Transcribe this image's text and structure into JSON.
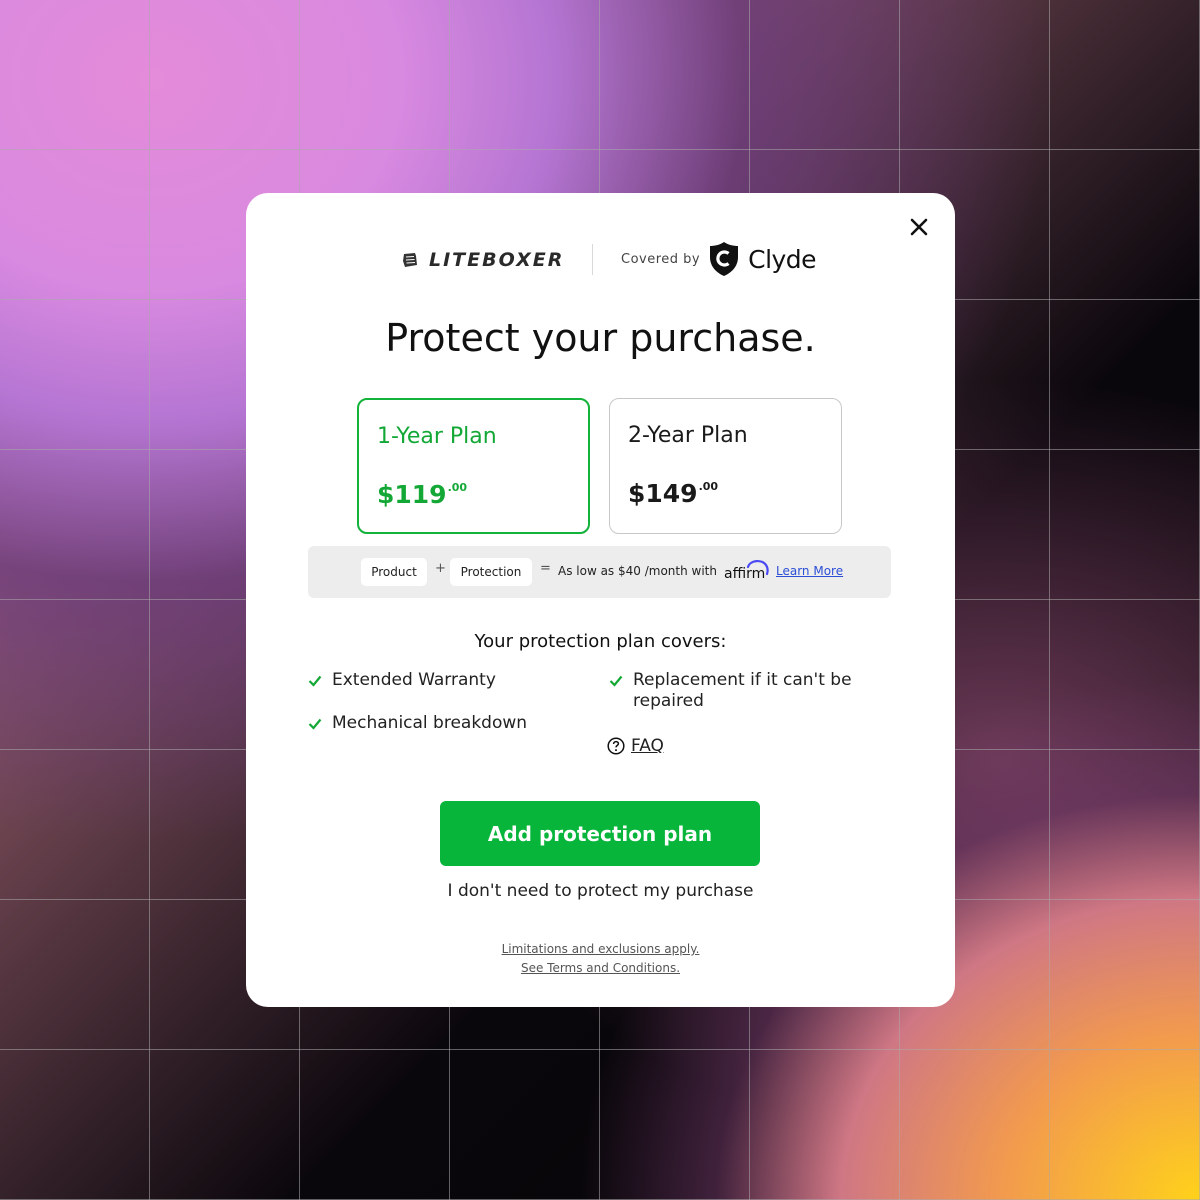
{
  "brand": {
    "merchant": "LITEBOXER",
    "covered_by": "Covered by",
    "provider": "Clyde"
  },
  "title": "Protect your purchase.",
  "plans": [
    {
      "name": "1-Year Plan",
      "price": "$119",
      "cents": ".00",
      "selected": true
    },
    {
      "name": "2-Year Plan",
      "price": "$149",
      "cents": ".00",
      "selected": false
    }
  ],
  "financing": {
    "product_label": "Product",
    "plus": "+",
    "protection_label": "Protection",
    "equals": "=",
    "text": "As low as $40 /month with",
    "learn_more": "Learn More",
    "affirm_logo_text": "affirm"
  },
  "coverage": {
    "title": "Your protection plan covers:",
    "items": [
      "Extended Warranty",
      "Mechanical breakdown",
      "Replacement if it can't be repaired"
    ],
    "faq_label": "FAQ"
  },
  "actions": {
    "add_label": "Add protection plan",
    "decline_label": "I don't need to protect my purchase"
  },
  "terms": {
    "line1": "Limitations and exclusions apply.",
    "line2": "See Terms and Conditions."
  },
  "colors": {
    "accent_green": "#07b53a",
    "link_blue": "#2c4fd6",
    "affirm_blue": "#4a4af4"
  },
  "icons": [
    "close-icon",
    "liteboxer-logo-icon",
    "clyde-shield-icon",
    "check-icon",
    "question-circle-icon",
    "affirm-logo-icon"
  ]
}
